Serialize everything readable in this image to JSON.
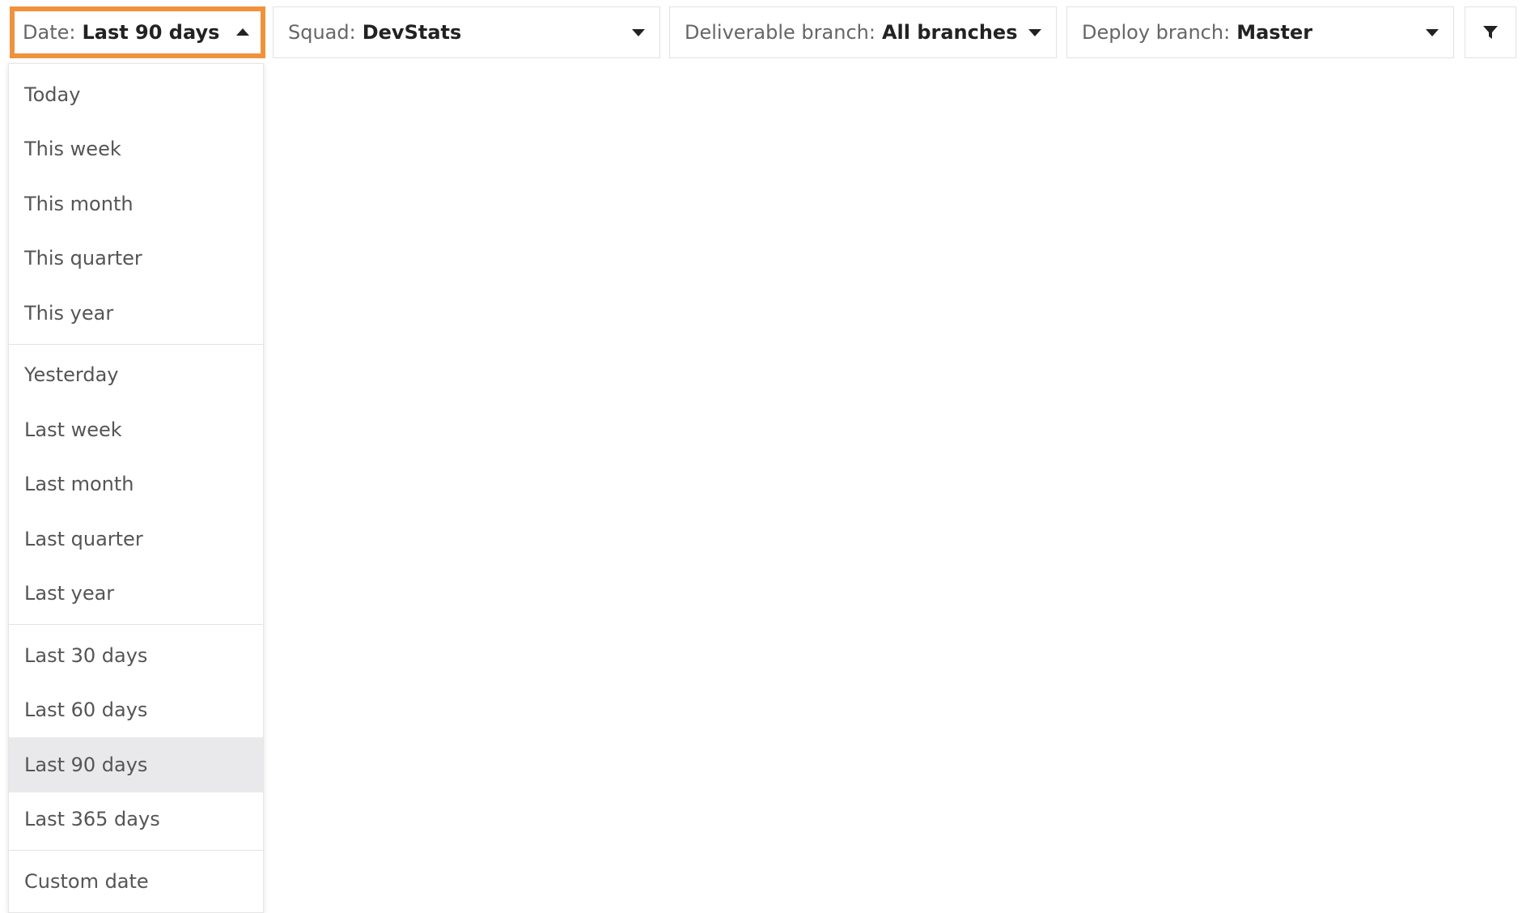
{
  "filters": {
    "date": {
      "key": "Date:",
      "value": "Last 90 days"
    },
    "squad": {
      "key": "Squad:",
      "value": "DevStats"
    },
    "deliverable_branch": {
      "key": "Deliverable branch:",
      "value": "All branches"
    },
    "deploy_branch": {
      "key": "Deploy branch:",
      "value": "Master"
    },
    "funnel_icon": "funnel-icon"
  },
  "date_dropdown": {
    "groups": [
      [
        "Today",
        "This week",
        "This month",
        "This quarter",
        "This year"
      ],
      [
        "Yesterday",
        "Last week",
        "Last month",
        "Last quarter",
        "Last year"
      ],
      [
        "Last 30 days",
        "Last 60 days",
        "Last 90 days",
        "Last 365 days"
      ],
      [
        "Custom date"
      ]
    ],
    "selected": "Last 90 days"
  },
  "colors": {
    "active_border": "#f0923b",
    "selected_bg": "#e9e9eb"
  }
}
